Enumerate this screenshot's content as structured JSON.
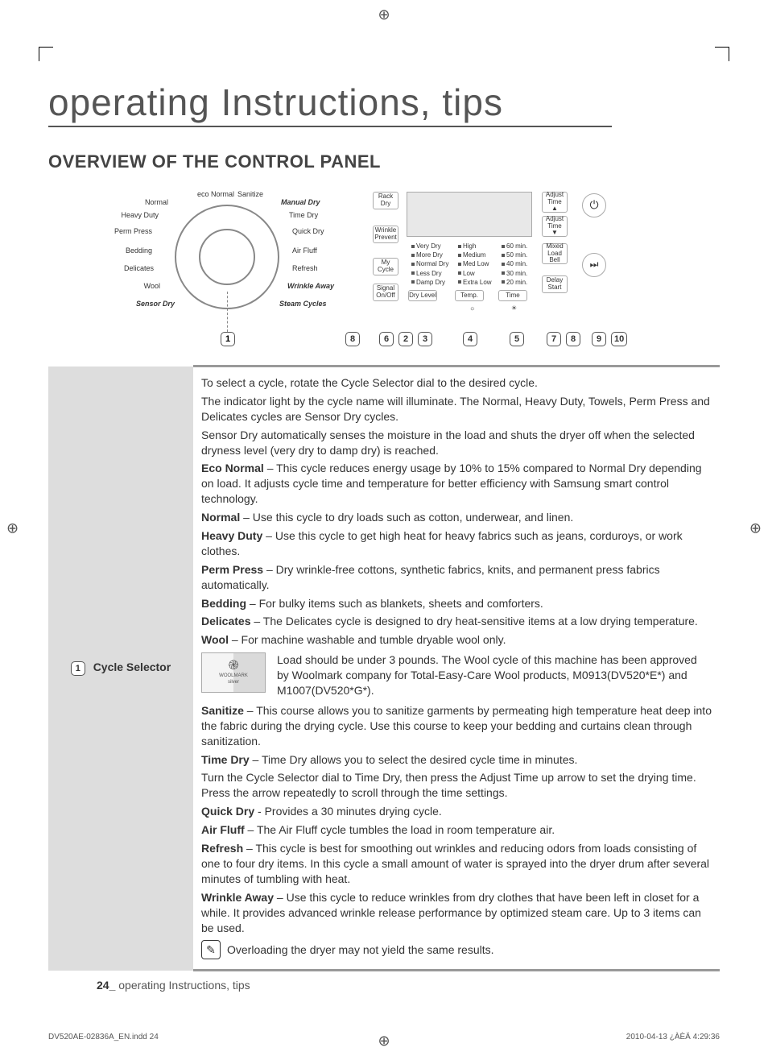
{
  "title": "operating Instructions, tips",
  "section": "OVERVIEW OF THE CONTROL PANEL",
  "dial": {
    "left_labels": [
      "Normal",
      "Heavy Duty",
      "Perm Press",
      "Bedding",
      "Delicates",
      "Wool",
      "Sensor Dry"
    ],
    "top_labels": [
      "eco Normal",
      "Sanitize"
    ],
    "right_labels": [
      "Manual Dry",
      "Time Dry",
      "Quick Dry",
      "Air Fluff",
      "Refresh",
      "Wrinkle Away",
      "Steam Cycles"
    ],
    "wool_icon": "❀",
    "sensor_icon": "❖",
    "steam_icon": "⎘"
  },
  "panel": {
    "rack": "Rack\nDry",
    "wrinkle": "Wrinkle\nPrevent",
    "mycycle": "My\nCycle",
    "signal": "Signal\nOn/Off",
    "adjup": "Adjust\nTime\n▲",
    "adjdn": "Adjust\nTime\n▼",
    "mixed": "Mixed\nLoad\nBell",
    "delay": "Delay\nStart",
    "drylevel_label": "Dry Level",
    "temp_label": "Temp.",
    "time_label": "Time",
    "power_glyph": "⏻",
    "play_glyph": "⏭",
    "sun_glyph": "☼",
    "light_glyph": "☀",
    "col_dry": [
      "Very Dry",
      "More Dry",
      "Normal Dry",
      "Less Dry",
      "Damp Dry"
    ],
    "col_temp": [
      "High",
      "Medium",
      "Med Low",
      "Low",
      "Extra Low"
    ],
    "col_time": [
      "60 min.",
      "50 min.",
      "40 min.",
      "30 min.",
      "20 min."
    ]
  },
  "callouts": {
    "c1": "1",
    "c2": "2",
    "c3": "3",
    "c4": "4",
    "c5": "5",
    "c6": "6",
    "c7": "7",
    "c8": "8",
    "c9": "9",
    "c10": "10"
  },
  "table_row": {
    "num": "1",
    "heading": "Cycle Selector"
  },
  "body": {
    "p1": "To select a cycle, rotate the Cycle Selector dial to the desired cycle.",
    "p2": "The indicator light by the cycle name will illuminate. The Normal, Heavy Duty, Towels, Perm Press and Delicates cycles are Sensor Dry cycles.",
    "p3": "Sensor Dry automatically senses the moisture in the load and shuts the dryer off when the selected dryness level (very dry to damp dry) is reached.",
    "eco_l": "Eco Normal",
    "eco": " – This cycle reduces energy usage by 10% to 15% compared to Normal Dry depending on load. It adjusts cycle time  and temperature for better efficiency with Samsung smart control technology.",
    "normal_l": "Normal",
    "normal": " – Use this cycle to dry loads such as cotton, underwear, and linen.",
    "heavy_l": "Heavy Duty",
    "heavy": " – Use this cycle to get high heat for heavy fabrics such as jeans, corduroys, or work clothes.",
    "perm_l": "Perm Press",
    "perm": " – Dry wrinkle-free cottons, synthetic fabrics, knits, and permanent press fabrics automatically.",
    "bed_l": "Bedding",
    "bed": " – For bulky items such as blankets, sheets and comforters.",
    "del_l": "Delicates",
    "del": " – The Delicates cycle is designed to dry heat-sensitive items at a low drying temperature.",
    "wool_l": "Wool",
    "wool": " – For machine washable and tumble dryable wool only.",
    "wool_detail": "Load should be under 3 pounds. The Wool cycle of  this machine has been approved by Woolmark company for Total-Easy-Care Wool products,  M0913(DV520*E*) and M1007(DV520*G*).",
    "san_l": "Sanitize",
    "san": " – This course allows you to sanitize garments by permeating high temperature heat deep into the fabric during the drying cycle. Use this course to keep your bedding and curtains clean through sanitization.",
    "td_l": "Time Dry",
    "td": " – Time Dry allows you to select the desired cycle time in minutes.",
    "td2": "Turn the Cycle Selector dial to Time Dry, then press the Adjust Time up arrow to set the drying time. Press the arrow repeatedly to scroll through the time settings.",
    "qd_l": "Quick Dry",
    "qd": " - Provides a 30 minutes drying cycle.",
    "af_l": "Air Fluff",
    "af": " – The Air Fluff cycle tumbles the load in room temperature air.",
    "rf_l": "Refresh",
    "rf": " – This cycle is best for smoothing out wrinkles and reducing odors from loads consisting of one to four dry items. In this cycle a small amount of water is sprayed into the dryer drum after several minutes of tumbling with heat.",
    "wa_l": "Wrinkle Away",
    "wa": " – Use this cycle to reduce wrinkles from dry clothes that have been left in closet for a while. It provides advanced wrinkle release performance by optimized steam care. Up to 3 items can be used.",
    "note": "Overloading the dryer may not yield the same results.",
    "note_glyph": "✎",
    "woolmark_label": "WOOLMARK",
    "woolmark_sub": "silver"
  },
  "footer": {
    "page_num": "24_",
    "page_label": " operating Instructions, tips",
    "ind": "DV520AE-02836A_EN.indd   24",
    "date": "2010-04-13   ¿ÀÈÄ 4:29:36"
  }
}
